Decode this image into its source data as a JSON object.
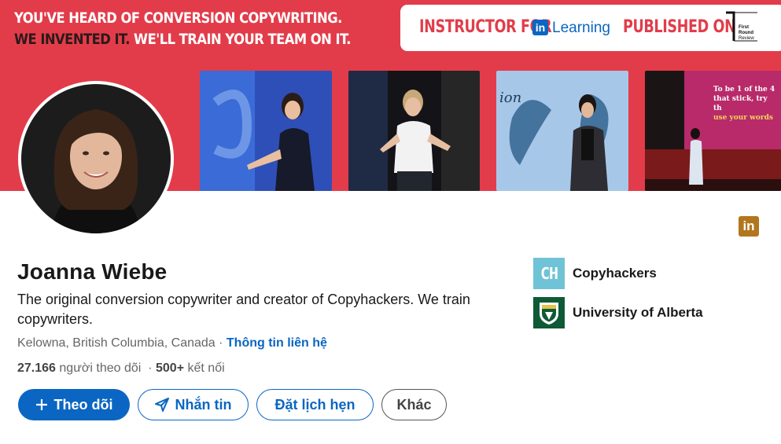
{
  "banner": {
    "tagline_line1": "YOU'VE HEARD OF CONVERSION COPYWRITING.",
    "tagline_line2a": "WE INVENTED IT.",
    "tagline_line2b": "WE'LL TRAIN YOUR TEAM ON IT.",
    "instructor_label": "INSTRUCTOR FOR",
    "linkedin_mark": "in",
    "learning_label": "Learning",
    "published_label": "PUBLISHED ON",
    "first_round_line1": "First",
    "first_round_line2": "Round",
    "first_round_line3": "Review",
    "photo_slide_text_1": "To be 1 of the 4",
    "photo_slide_text_2": "that stick, try th",
    "photo_slide_text_3": "use your words",
    "photo_stage_text": "ion"
  },
  "profile": {
    "name": "Joanna Wiebe",
    "headline": "The original conversion copywriter and creator of Copyhackers. We train copywriters.",
    "location": "Kelowna, British Columbia, Canada",
    "separator": " · ",
    "contact_info": "Thông tin liên hệ",
    "followers_count": "27.166",
    "followers_label": "người theo dõi",
    "connections_sep": "·",
    "connections_count": "500+",
    "connections_label": "kết nối"
  },
  "actions": {
    "follow": "Theo dõi",
    "message": "Nhắn tin",
    "book": "Đặt lịch hẹn",
    "more": "Khác"
  },
  "organizations": [
    {
      "logo_text": "CH",
      "name": "Copyhackers"
    },
    {
      "name": "University of Alberta"
    }
  ],
  "icons": {
    "linkedin_badge": "in"
  },
  "colors": {
    "banner": "#e23c4a",
    "accent": "#0a66c2",
    "linkedin_gold": "#b2771e",
    "copyhackers": "#6fc3d6",
    "ualberta": "#0e5a36"
  }
}
